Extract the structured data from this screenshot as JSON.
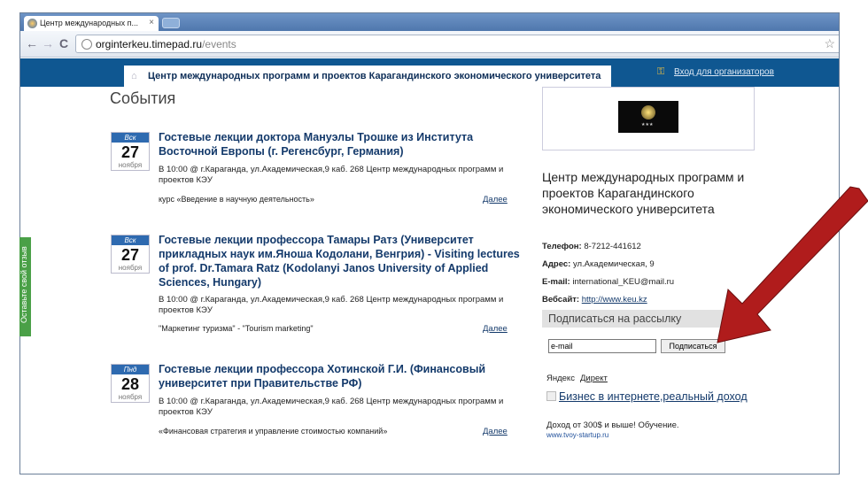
{
  "browser": {
    "tab_title": "Центр международных п...",
    "tab_close": "×",
    "url_host": "orginterkeu.timepad.ru",
    "url_path": "/events"
  },
  "header": {
    "org_title": "Центр международных программ и проектов Карагандинского экономического университета",
    "login_label": "Вход для организаторов"
  },
  "feedback_label": "Оставьте свой отзыв",
  "page_title": "События",
  "more_label": "Далее",
  "events": [
    {
      "dow": "Вск",
      "day": "27",
      "month": "ноября",
      "title": "Гостевые лекции доктора Мануэлы Трошке из Института Восточной Европы (г. Регенсбург, Германия)",
      "meta": "В 10:00 @ г.Караганда, ул.Академическая,9 каб. 268 Центр международных программ и проектов КЭУ",
      "desc": "курс «Введение в научную деятельность»"
    },
    {
      "dow": "Вск",
      "day": "27",
      "month": "ноября",
      "title": "Гостевые лекции профессора Тамары Ратз (Университет прикладных наук им.Яноша Кодолани, Венгрия) - Visiting lectures of prof. Dr.Tamara Ratz (Kodolanyi Janos University of Applied Sciences, Hungary)",
      "meta": "В 10:00 @ г.Караганда, ул.Академическая,9 каб. 268 Центр международных программ и проектов КЭУ",
      "desc": "\"Маркетинг туризма\" - \"Tourism marketing\""
    },
    {
      "dow": "Пнд",
      "day": "28",
      "month": "ноября",
      "title": "Гостевые лекции профессора Хотинской Г.И. (Финансовый университет при Правительстве РФ)",
      "meta": "В 10:00 @ г.Караганда, ул.Академическая,9 каб. 268 Центр международных программ и проектов КЭУ",
      "desc": "«Финансовая стратегия и управление стоимостью компаний»"
    }
  ],
  "sidebar": {
    "org_name": "Центр международных программ и проектов Карагандинского экономического университета",
    "phone_label": "Телефон:",
    "phone": "8-7212-441612",
    "address_label": "Адрес:",
    "address": "ул.Академическая, 9",
    "email_label": "E-mail:",
    "email": "international_KEU@mail.ru",
    "site_label": "Вебсайт:",
    "site": "http://www.keu.kz",
    "subscribe_title": "Подписаться на рассылку",
    "email_value": "e-mail",
    "subscribe_button": "Подписаться"
  },
  "ads": {
    "yandex": "Яндекс",
    "direct": "Директ",
    "title": "Бизнес в интернете,реальный доход",
    "text": "Доход от 300$ и выше! Обучение.",
    "url": "www.tvoy-startup.ru"
  },
  "colors": {
    "header_blue": "#0f5791",
    "title_blue": "#143a6b",
    "feedback_green": "#4aa047",
    "arrow_red": "#b01c1c"
  }
}
